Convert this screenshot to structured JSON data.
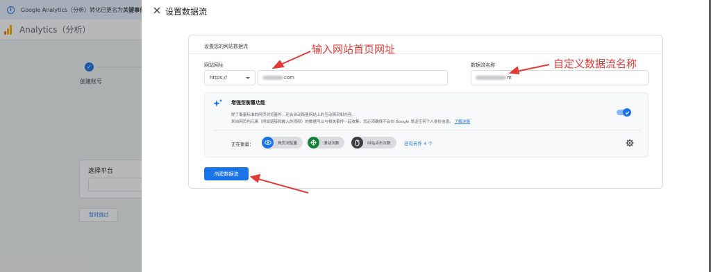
{
  "background": {
    "notice_prefix": "Google Analytics（分析）转化已更名为",
    "notice_bold": "关键事件。",
    "app_title": "Analytics（分析）",
    "step_label": "创建账号",
    "platform_title": "选择平台",
    "skip_button": "暂时跳过"
  },
  "dialog": {
    "title": "设置数据流",
    "card_heading": "设置您的网站数据流",
    "website_url_label": "网站网址",
    "protocol_value": "https://",
    "url_value_suffix": "com",
    "stream_name_label": "数据流名称",
    "stream_name_suffix": "m",
    "enhanced": {
      "title": "增强型衡量功能",
      "desc_line1": "除了衡量标准的网页浏览量外，还会自动衡量网站上的互动情况和内容。",
      "desc_line2": "来自网页内元素（例如链接和嵌入的视频）的数据可以与相关事件一起收集。您必须确保不会向 Google 发送任何个人身份信息。",
      "learn_more": "了解详情",
      "toggle_on": true,
      "measuring_label": "正在衡量：",
      "chips": [
        {
          "label": "网页浏览量",
          "color": "#1a73e8",
          "icon": "eye-icon"
        },
        {
          "label": "滚动次数",
          "color": "#188038",
          "icon": "target-icon"
        },
        {
          "label": "出站点击次数",
          "color": "#3c4043",
          "icon": "mouse-icon"
        }
      ],
      "more_link": "还有另外 4 个"
    },
    "create_button": "创建数据流"
  },
  "annotations": {
    "url_hint": "输入网站首页网址",
    "name_hint": "自定义数据流名称"
  },
  "colors": {
    "accent": "#1a73e8",
    "annotation": "#e53935"
  }
}
